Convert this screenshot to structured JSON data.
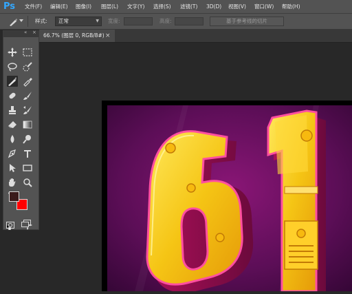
{
  "app": {
    "logo": "Ps"
  },
  "menu": {
    "items": [
      "文件(F)",
      "编辑(E)",
      "图像(I)",
      "图层(L)",
      "文字(Y)",
      "选择(S)",
      "滤镜(T)",
      "3D(D)",
      "视图(V)",
      "窗口(W)",
      "帮助(H)"
    ]
  },
  "options": {
    "style_label": "样式:",
    "style_value": "正常",
    "width_label": "宽度:",
    "height_label": "高度:",
    "guides_button": "基于参考线的切片"
  },
  "document": {
    "tab_title": "66.7% (图层 0, RGB/8#)",
    "close_glyph": "×",
    "artwork_text": "61"
  },
  "toolbar": {
    "collapse_glyph": "«",
    "close_glyph": "×",
    "more_glyph": "•••",
    "foreground_color": "#3a1b1b",
    "background_color": "#ff0000",
    "tools": [
      "move-tool",
      "marquee-tool",
      "lasso-tool",
      "quick-selection-tool",
      "slice-tool",
      "eyedropper-tool",
      "healing-brush-tool",
      "brush-tool",
      "clone-stamp-tool",
      "history-brush-tool",
      "eraser-tool",
      "gradient-tool",
      "blur-tool",
      "dodge-tool",
      "pen-tool",
      "type-tool",
      "path-selection-tool",
      "rectangle-tool",
      "hand-tool",
      "zoom-tool",
      "quick-mask-mode",
      "screen-mode"
    ]
  },
  "colors": {
    "accent": "#33a8ff",
    "panel": "#535353",
    "workspace": "#282828",
    "artwork_yellow": "#f5c515",
    "artwork_magenta": "#c0166a"
  }
}
